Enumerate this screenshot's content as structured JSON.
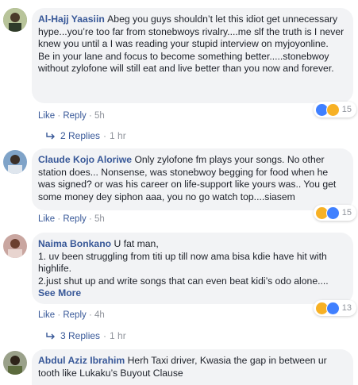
{
  "comments": [
    {
      "author": "Al-Hajj Yaasiin",
      "text": "Abeg you guys shouldn’t let this idiot get unnecessary hype...you’re too far from stonebwoys rivalry....me slf the truth is I never knew you until a I was reading your stupid interview on myjoyonline.\nBe in your lane and focus to become something better.....stonebwoy without zylofone will still eat and live better than you now and forever.",
      "reaction_count": "15",
      "like": "Like",
      "reply": "Reply",
      "time": "5h",
      "replies": "2 Replies",
      "replies_time": "1 hr"
    },
    {
      "author": "Claude Kojo Aloriwe",
      "text": "Only zylofone fm plays your songs. No other station does... Nonsense, was stonebwoy begging for food when he was signed? or was his career on life-support like yours was.. You get some money dey siphon aaa, you no go watch top....siasem",
      "reaction_count": "15",
      "like": "Like",
      "reply": "Reply",
      "time": "5h"
    },
    {
      "author": "Naima Bonkano",
      "text": "U fat man,\n1. uv been struggling from titi up till now ama bisa kdie have hit with highlife.\n2.just shut up and write songs that can even beat kidi’s odo alone....",
      "see_more": "See More",
      "reaction_count": "13",
      "like": "Like",
      "reply": "Reply",
      "time": "4h",
      "replies": "3 Replies",
      "replies_time": "1 hr"
    },
    {
      "author": "Abdul Aziz Ibrahim",
      "text": "Herh Taxi driver, Kwasia the gap in between ur tooth like Lukaku’s Buyout Clause"
    }
  ],
  "separator": "·",
  "colors": {
    "link": "#385898",
    "bubble": "#f2f3f5",
    "meta": "#90949c"
  },
  "icons": {
    "like": "like-reaction-icon",
    "haha": "haha-reaction-icon",
    "reply_arrow": "reply-arrow-icon"
  }
}
